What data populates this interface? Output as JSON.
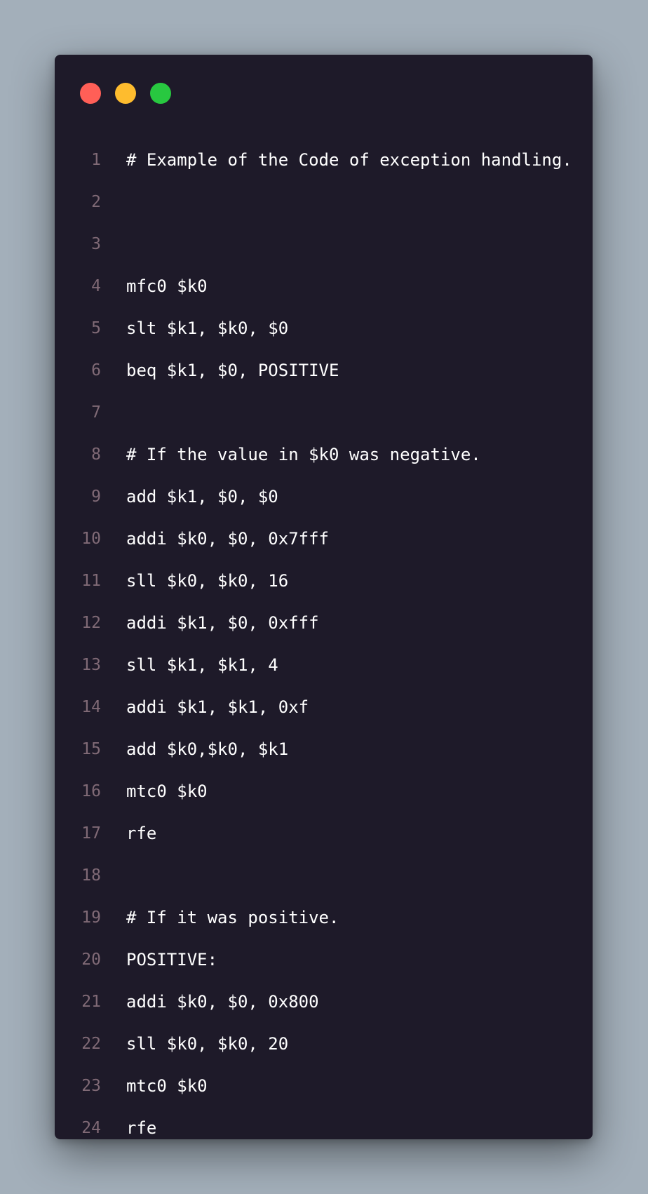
{
  "window": {
    "traffic_lights": [
      {
        "name": "close",
        "color": "#ff5f57"
      },
      {
        "name": "minimize",
        "color": "#febc2e"
      },
      {
        "name": "maximize",
        "color": "#28c840"
      }
    ]
  },
  "code": {
    "lines": [
      {
        "num": "1",
        "text": "# Example of the Code of exception handling."
      },
      {
        "num": "2",
        "text": ""
      },
      {
        "num": "3",
        "text": ""
      },
      {
        "num": "4",
        "text": "mfc0 $k0"
      },
      {
        "num": "5",
        "text": "slt $k1, $k0, $0"
      },
      {
        "num": "6",
        "text": "beq $k1, $0, POSITIVE"
      },
      {
        "num": "7",
        "text": ""
      },
      {
        "num": "8",
        "text": "# If the value in $k0 was negative."
      },
      {
        "num": "9",
        "text": "add $k1, $0, $0"
      },
      {
        "num": "10",
        "text": "addi $k0, $0, 0x7fff"
      },
      {
        "num": "11",
        "text": "sll $k0, $k0, 16"
      },
      {
        "num": "12",
        "text": "addi $k1, $0, 0xfff"
      },
      {
        "num": "13",
        "text": "sll $k1, $k1, 4"
      },
      {
        "num": "14",
        "text": "addi $k1, $k1, 0xf"
      },
      {
        "num": "15",
        "text": "add $k0,$k0, $k1"
      },
      {
        "num": "16",
        "text": "mtc0 $k0"
      },
      {
        "num": "17",
        "text": "rfe"
      },
      {
        "num": "18",
        "text": ""
      },
      {
        "num": "19",
        "text": "# If it was positive."
      },
      {
        "num": "20",
        "text": "POSITIVE:"
      },
      {
        "num": "21",
        "text": "addi $k0, $0, 0x800"
      },
      {
        "num": "22",
        "text": "sll $k0, $k0, 20"
      },
      {
        "num": "23",
        "text": "mtc0 $k0"
      },
      {
        "num": "24",
        "text": "rfe"
      }
    ]
  }
}
